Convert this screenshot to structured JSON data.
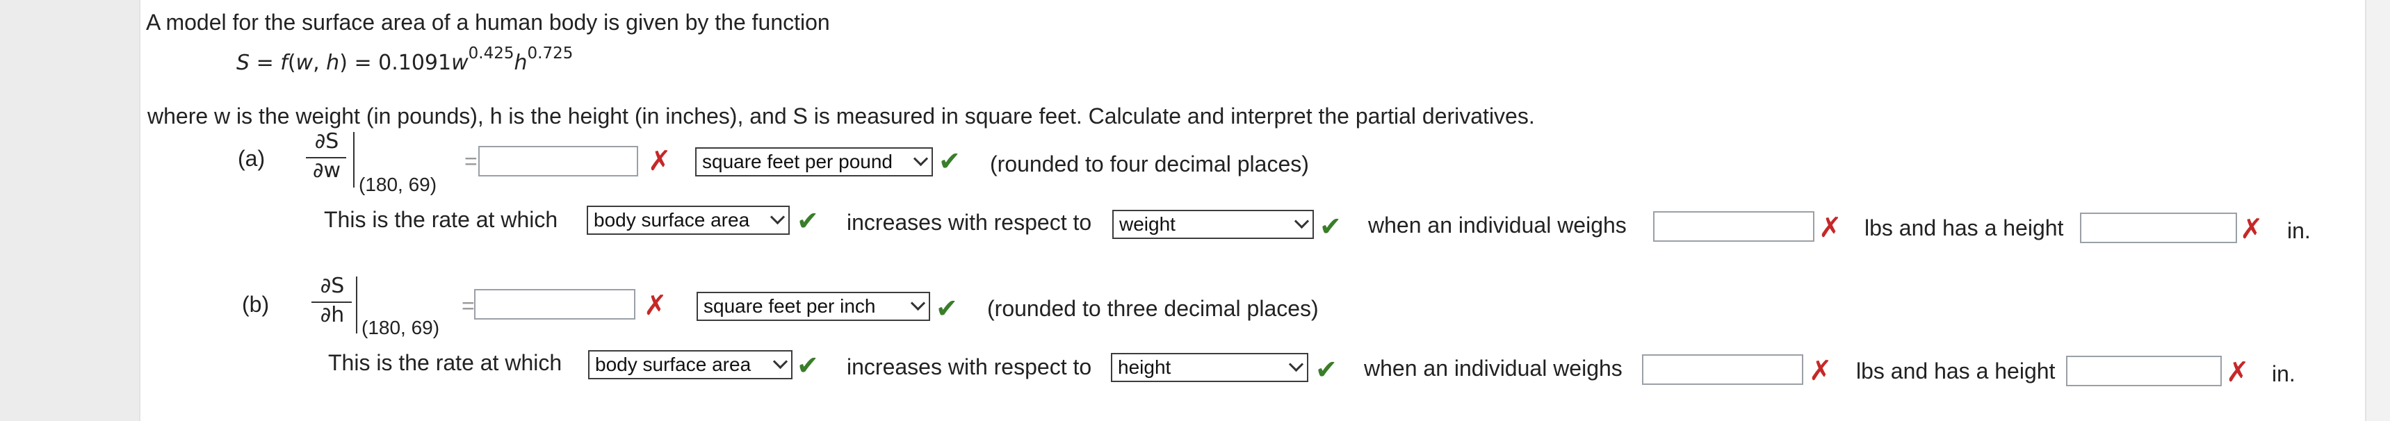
{
  "intro": "A model for the surface area of a human body is given by the function",
  "formula": {
    "lhs": "S = ",
    "func": "f",
    "args_open": "(",
    "w": "w",
    "comma": ", ",
    "h": "h",
    "args_close": ")",
    "eq": " = 0.1091",
    "w2": "w",
    "exp_w": "0.425",
    "h2": "h",
    "exp_h": "0.725"
  },
  "description": "where w is the weight (in pounds), h is the height (in inches), and S is measured in square feet. Calculate and interpret the partial derivatives.",
  "colors": {
    "check": "#3a7d2a",
    "cross": "#c62828"
  },
  "icons": {
    "correct": "check-icon",
    "incorrect": "x-icon",
    "dropdown": "chevron-down-icon"
  },
  "parts": {
    "a": {
      "label": "(a)",
      "numerator": "∂S",
      "denominator": "∂w",
      "eval_point": "(180, 69)",
      "equals": "=",
      "answer_value": "",
      "unit_selected": "square feet per pound",
      "rounding_note": "(rounded to four decimal places)",
      "interp_prefix": "This is the rate at which",
      "quantity_selected": "body surface area",
      "increases_text": "increases with respect to",
      "variable_selected": "weight",
      "when_text": "when an individual weighs",
      "weight_value": "",
      "lbs_text": "lbs and has a height",
      "height_value": "",
      "in_text": "in."
    },
    "b": {
      "label": "(b)",
      "numerator": "∂S",
      "denominator": "∂h",
      "eval_point": "(180, 69)",
      "equals": "=",
      "answer_value": "",
      "unit_selected": "square feet per inch",
      "rounding_note": "(rounded to three decimal places)",
      "interp_prefix": "This is the rate at which",
      "quantity_selected": "body surface area",
      "increases_text": "increases with respect to",
      "variable_selected": "height",
      "when_text": "when an individual weighs",
      "weight_value": "",
      "lbs_text": "lbs and has a height",
      "height_value": "",
      "in_text": "in."
    }
  }
}
